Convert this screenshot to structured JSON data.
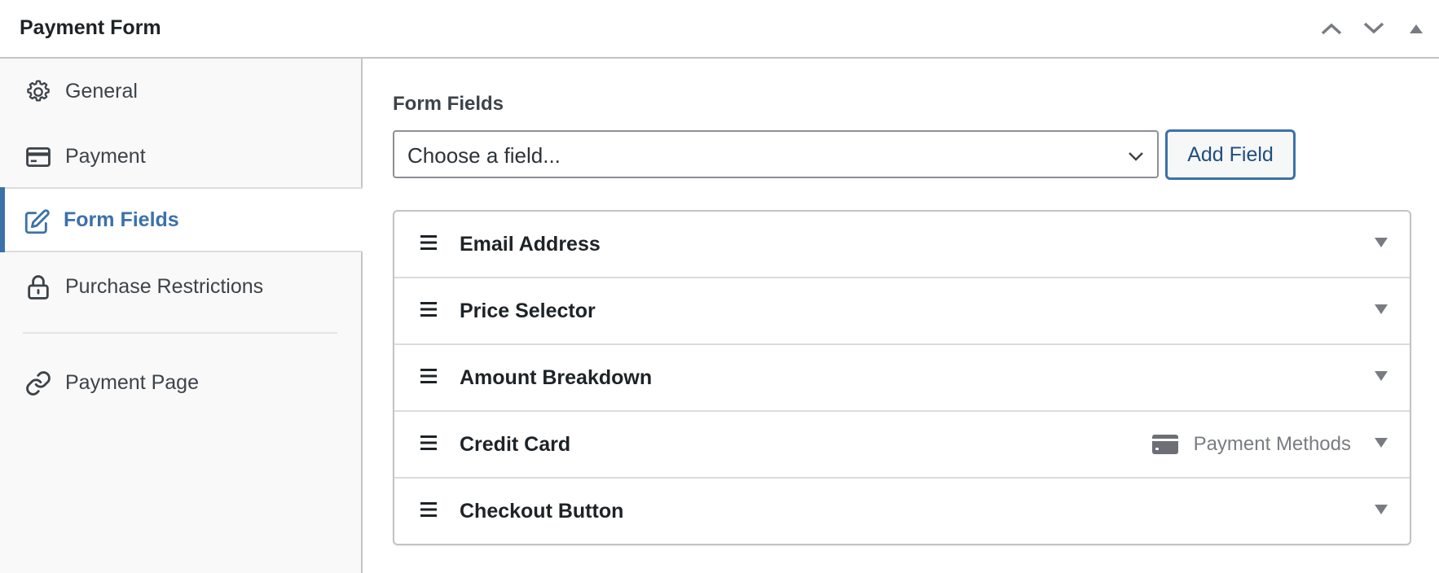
{
  "header": {
    "title": "Payment Form",
    "controls": {
      "move_up_icon": "chevron-up-icon",
      "move_down_icon": "chevron-down-icon",
      "toggle_icon": "triangle-up-icon"
    }
  },
  "sidebar": {
    "items": [
      {
        "label": "General",
        "icon": "gear-icon",
        "active": false
      },
      {
        "label": "Payment",
        "icon": "credit-card-icon",
        "active": false
      },
      {
        "label": "Form Fields",
        "icon": "edit-icon",
        "active": true
      },
      {
        "label": "Purchase Restrictions",
        "icon": "lock-icon",
        "active": false
      }
    ],
    "secondary_items": [
      {
        "label": "Payment Page",
        "icon": "link-icon"
      }
    ]
  },
  "main": {
    "section_label": "Form Fields",
    "field_select": {
      "value": "Choose a field...",
      "icon": "chevron-down-icon"
    },
    "add_field_button": "Add Field",
    "fields": [
      {
        "name": "Email Address"
      },
      {
        "name": "Price Selector"
      },
      {
        "name": "Amount Breakdown"
      },
      {
        "name": "Credit Card",
        "meta_label": "Payment Methods",
        "meta_icon": "credit-card-icon"
      },
      {
        "name": "Checkout Button"
      }
    ]
  },
  "colors": {
    "accent": "#3c71aa",
    "text": "#1d2327",
    "muted": "#787c82",
    "border": "#c3c4c7",
    "sidebar_bg": "#f9f9f9"
  }
}
